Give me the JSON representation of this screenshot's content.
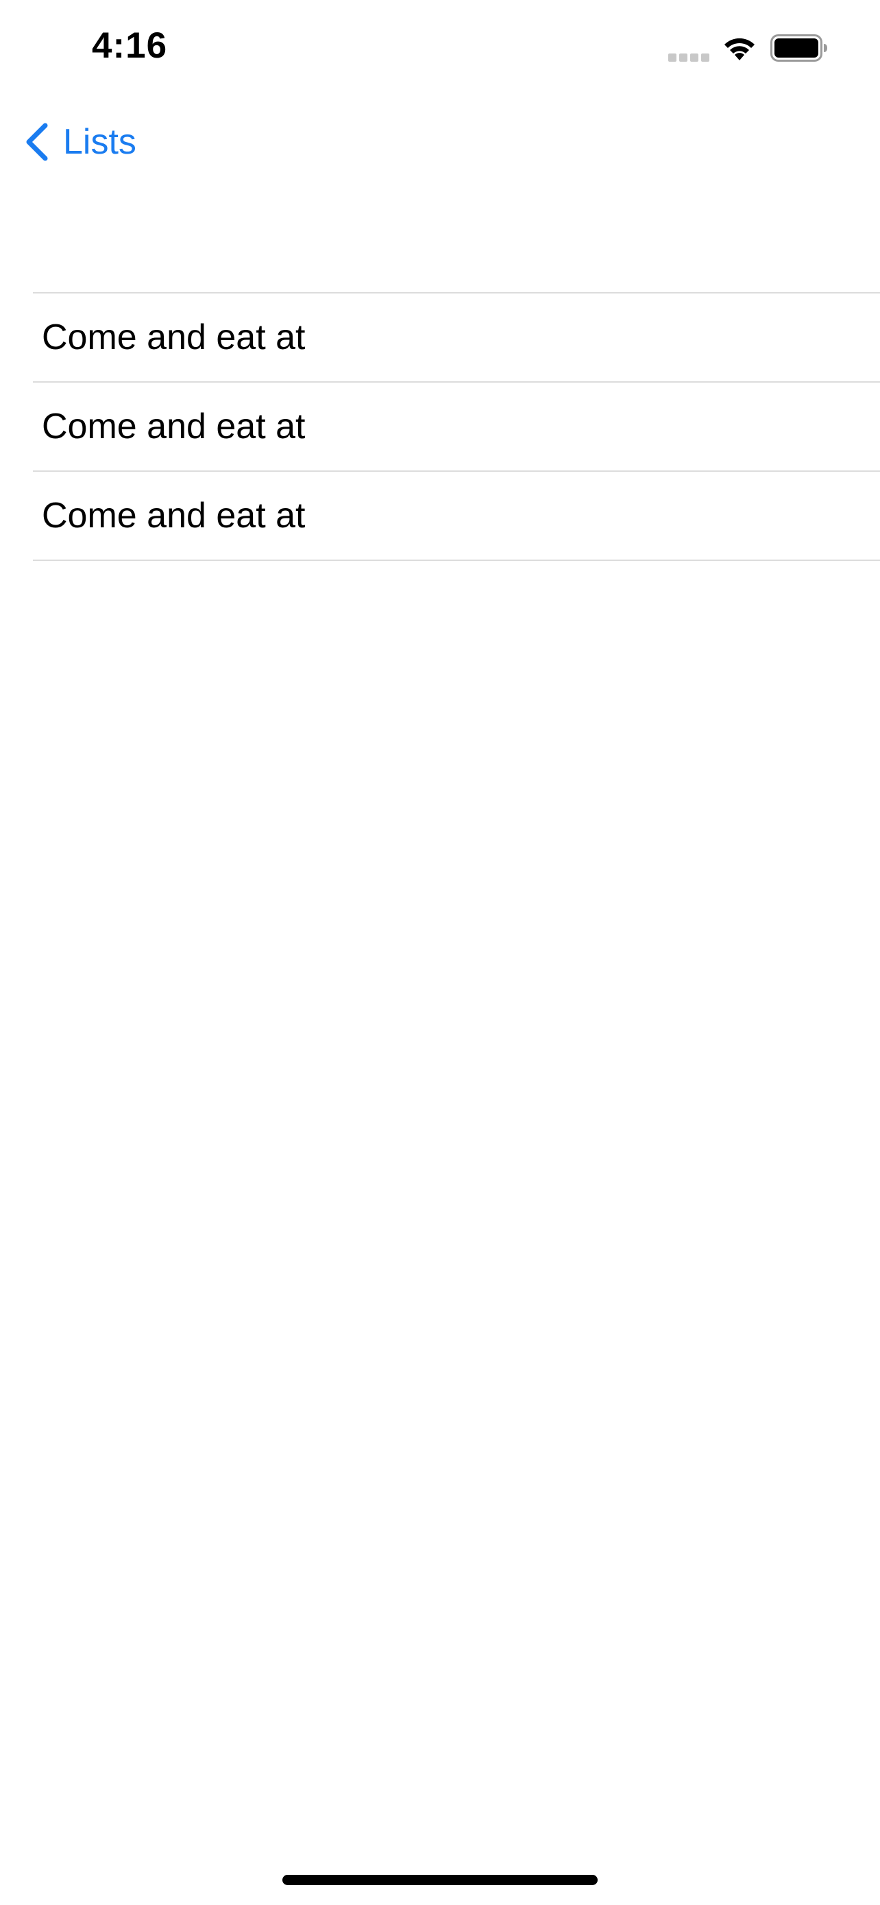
{
  "status_bar": {
    "time": "4:16",
    "icons": [
      "cellular-signal-icon",
      "wifi-icon",
      "battery-icon"
    ]
  },
  "nav": {
    "back_label": "Lists",
    "back_icon": "chevron-left-icon",
    "accent_color": "#1a7cf0"
  },
  "list": {
    "items": [
      {
        "label": "Come and eat at"
      },
      {
        "label": "Come and eat at"
      },
      {
        "label": "Come and eat at"
      }
    ]
  }
}
